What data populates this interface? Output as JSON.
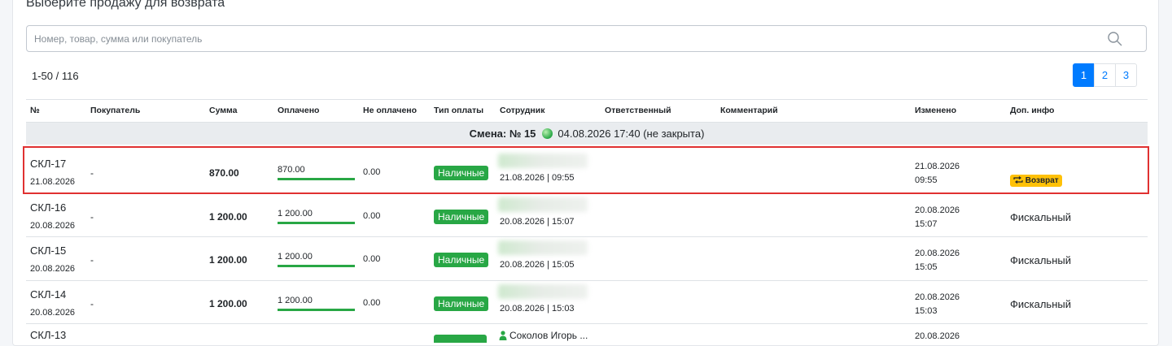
{
  "page": {
    "title": "Выберите продажу для возврата",
    "search_placeholder": "Номер, товар, сумма или покупатель",
    "count": "1-50 / 116"
  },
  "pagination": [
    "1",
    "2",
    "3"
  ],
  "pagination_active": "1",
  "columns": {
    "num": "№",
    "buyer": "Покупатель",
    "sum": "Сумма",
    "paid": "Оплачено",
    "unpaid": "Не оплачено",
    "paytype": "Тип оплаты",
    "employee": "Сотрудник",
    "responsible": "Ответственный",
    "comment": "Комментарий",
    "changed": "Изменено",
    "extra": "Доп. инфо"
  },
  "shift": {
    "label": "Смена: № 15",
    "date": "04.08.2026 17:40 (не закрыта)"
  },
  "rows": [
    {
      "num": "СКЛ-17",
      "date": "21.08.2026",
      "buyer": "-",
      "sum": "870.00",
      "paid": "870.00",
      "unpaid": "0.00",
      "paytype": "Наличные",
      "emp_date": "21.08.2026 | 09:55",
      "changed_date": "21.08.2026",
      "changed_time": "09:55",
      "extra": "",
      "badge": "Возврат"
    },
    {
      "num": "СКЛ-16",
      "date": "20.08.2026",
      "buyer": "-",
      "sum": "1 200.00",
      "paid": "1 200.00",
      "unpaid": "0.00",
      "paytype": "Наличные",
      "emp_date": "20.08.2026 | 15:07",
      "changed_date": "20.08.2026",
      "changed_time": "15:07",
      "extra": "Фискальный",
      "badge": ""
    },
    {
      "num": "СКЛ-15",
      "date": "20.08.2026",
      "buyer": "-",
      "sum": "1 200.00",
      "paid": "1 200.00",
      "unpaid": "0.00",
      "paytype": "Наличные",
      "emp_date": "20.08.2026 | 15:05",
      "changed_date": "20.08.2026",
      "changed_time": "15:05",
      "extra": "Фискальный",
      "badge": ""
    },
    {
      "num": "СКЛ-14",
      "date": "20.08.2026",
      "buyer": "-",
      "sum": "1 200.00",
      "paid": "1 200.00",
      "unpaid": "0.00",
      "paytype": "Наличные",
      "emp_date": "20.08.2026 | 15:03",
      "changed_date": "20.08.2026",
      "changed_time": "15:03",
      "extra": "Фискальный",
      "badge": ""
    }
  ],
  "partial_row": {
    "num": "СКЛ-13",
    "employee": "Соколов Игорь ...",
    "changed_date": "20.08.2026"
  },
  "colors": {
    "accent": "#007bff",
    "success": "#28a745",
    "warning": "#ffc107",
    "highlight": "#e03131"
  },
  "icons": {
    "search": "search-icon",
    "shift_status": "status-dot-icon",
    "return": "repeat-icon",
    "person": "user-icon"
  }
}
